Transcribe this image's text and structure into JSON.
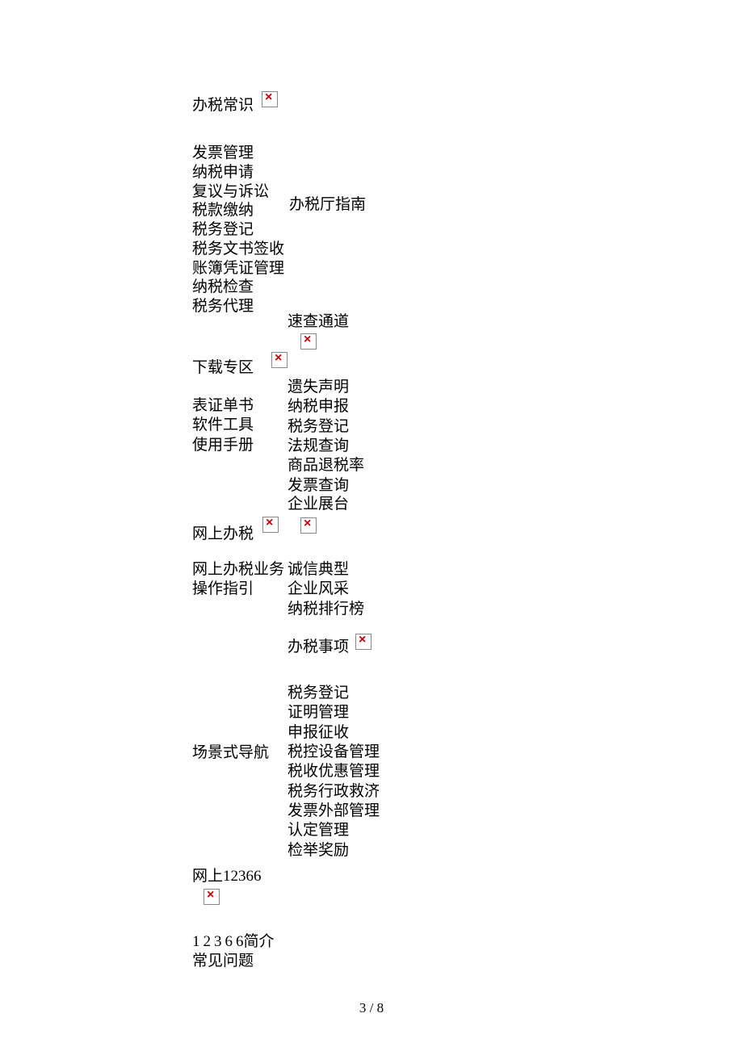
{
  "section1": {
    "title": "办税常识",
    "items": [
      "发票管理",
      "纳税申请",
      "复议与诉讼",
      "税款缴纳",
      "税务登记",
      "税务文书签收",
      "账簿凭证管理",
      "纳税检查",
      "税务代理"
    ],
    "right_label": "办税厅指南"
  },
  "section2a": {
    "title": "速查通道",
    "items": [
      "遗失声明",
      "纳税申报",
      "税务登记",
      "法规查询",
      "商品退税率",
      "发票查询"
    ]
  },
  "section2b": {
    "title": "下载专区",
    "items": [
      "表证单书",
      "软件工具",
      "使用手册"
    ]
  },
  "section3a": {
    "title": "企业展台",
    "items": [
      "诚信典型",
      "企业风采",
      "纳税排行榜"
    ]
  },
  "section3b": {
    "title": "网上办税",
    "items": [
      "网上办税业务",
      "操作指引"
    ]
  },
  "section4a": {
    "title": "办税事项",
    "items": [
      "税务登记",
      "证明管理",
      "申报征收",
      "税控设备管理",
      "税收优惠管理",
      "税务行政救济",
      "发票外部管理",
      "认定管理",
      "检举奖励"
    ]
  },
  "section4b": {
    "title": "场景式导航"
  },
  "section5": {
    "title": "网上12366",
    "item0_prefix": "1236",
    "item0_suffix": "6简介",
    "items_rest": [
      "常见问题"
    ]
  },
  "page": {
    "current": "3",
    "total": "8",
    "sep": " / "
  }
}
